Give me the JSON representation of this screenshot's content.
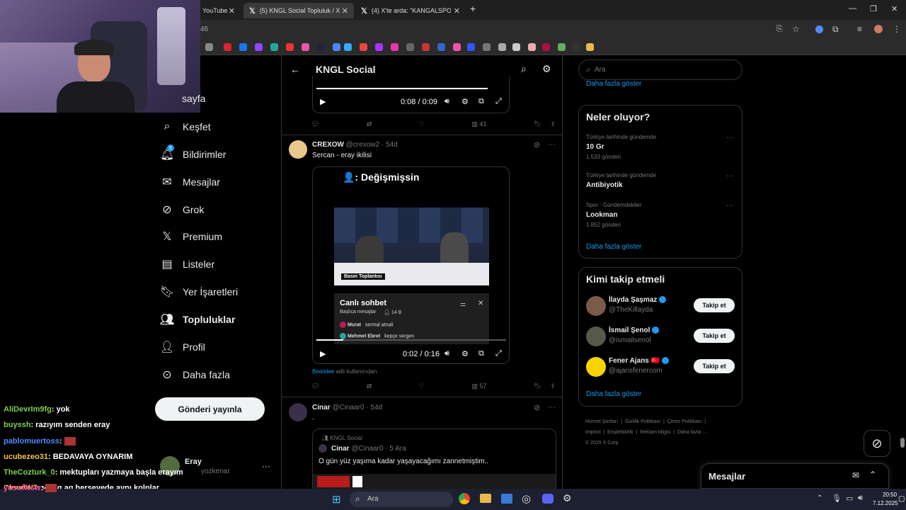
{
  "browser": {
    "tabs": [
      {
        "label": "YouTube"
      },
      {
        "label": "(5) KNGL Social Topluluk / X"
      },
      {
        "label": "(4) X'te arda: \"KANGALSPOR-m"
      }
    ],
    "new_tab": "+",
    "address_fragment": "46"
  },
  "nav": {
    "items": [
      {
        "label": "sayfa"
      },
      {
        "label": "Keşfet"
      },
      {
        "label": "Bildirimler",
        "badge": "5"
      },
      {
        "label": "Mesajlar"
      },
      {
        "label": "Grok"
      },
      {
        "label": "Premium"
      },
      {
        "label": "Listeler"
      },
      {
        "label": "Yer İşaretleri"
      },
      {
        "label": "Topluluklar"
      },
      {
        "label": "Profil"
      },
      {
        "label": "Daha fazla"
      }
    ],
    "post_button": "Gönderi yayınla",
    "account": {
      "name": "Eray",
      "handle": "yozkenar",
      "more": "···"
    }
  },
  "main": {
    "header_title": "KNGL Social",
    "post1": {
      "time": "0:08 / 0:09",
      "views": "41"
    },
    "post2": {
      "author": "CREXOW",
      "handle": "@crexow2",
      "date": "54d",
      "text": "Sercan - eray ikilisi",
      "video_caption": "👤: Değişmişsin",
      "press_label": "Basın Toplantısı",
      "chat_title": "Canlı sohbet",
      "chat_sub": "Başlıca mesajlar",
      "chat_count": "14 B",
      "chat_msgs": [
        {
          "user": "Murat",
          "msg": "sermal atnali"
        },
        {
          "user": "Mehmet Ebret",
          "msg": "kepçe sergen"
        }
      ],
      "time": "0:02 / 0:16",
      "attribution_user": "Beatslee",
      "attribution_rest": "adlı kullanıcıdan",
      "views": "57"
    },
    "post3": {
      "author": "Cinar",
      "handle": "@Cinaar0",
      "date": "54d",
      "text": ".",
      "quote_community": "KNGL Social",
      "quote_author": "Cinar",
      "quote_handle": "@Cinaar0",
      "quote_date": "5 Ara",
      "quote_text": "O gün yüz yaşıma kadar yaşayacağımı zannetmiştim.."
    }
  },
  "right": {
    "search_placeholder": "Ara",
    "show_more_top": "Daha fazla göster",
    "trends_title": "Neler oluyor?",
    "trends": [
      {
        "category": "Türkiye tarihinde gündemde",
        "name": "10 Gr",
        "count": "1.533 gönderi"
      },
      {
        "category": "Türkiye tarihinde gündemde",
        "name": "Antibiyotik",
        "count": ""
      },
      {
        "category": "Spor · Gündemdekiler",
        "name": "Lookman",
        "count": "1.852 gönderi"
      }
    ],
    "trends_more": "Daha fazla göster",
    "who_title": "Kimi takip etmeli",
    "who": [
      {
        "name": "İlayda Şaşmaz",
        "handle": "@TheKillayda",
        "button": "Takip et"
      },
      {
        "name": "İsmail Şenol",
        "handle": "@ismailsenol",
        "button": "Takip et"
      },
      {
        "name": "Fener Ajans 🇹🇷",
        "handle": "@ajansfenercom",
        "button": "Takip et"
      }
    ],
    "who_more": "Daha fazla göster",
    "footer": [
      "Hizmet Şartları",
      "Gizlilik Politikası",
      "Çerez Politikası",
      "Imprint",
      "Erişilebilirlik",
      "Reklam bilgisi",
      "Daha fazla ···",
      "© 2025 X Corp."
    ],
    "messages_label": "Mesajlar"
  },
  "chat": [
    {
      "user": "AliDevrIm9fg",
      "color": "#7cd14b",
      "text": ": yok"
    },
    {
      "user": "buyssh",
      "color": "#7cd14b",
      "text": ": razıyım senden eray"
    },
    {
      "user": "pablomuertoss",
      "color": "#4f8cff",
      "text": ":"
    },
    {
      "user": "ucubezeo31",
      "color": "#f2c14e",
      "text": ": BEDAVAYA OYNARIM"
    },
    {
      "user": "TheCozturk_0",
      "color": "#7cd14b",
      "text": ": mektupları yazmaya başla erayım"
    },
    {
      "user": "CloudW7",
      "color": "#f2c14e",
      "text": ": ya sg aq herseyede aynı kolplar"
    },
    {
      "user": "yusufwsw",
      "color": "#ff4fa3",
      "text": ":"
    }
  ],
  "taskbar": {
    "search": "Ara",
    "time": "20:50",
    "date": "7.12.2025"
  }
}
